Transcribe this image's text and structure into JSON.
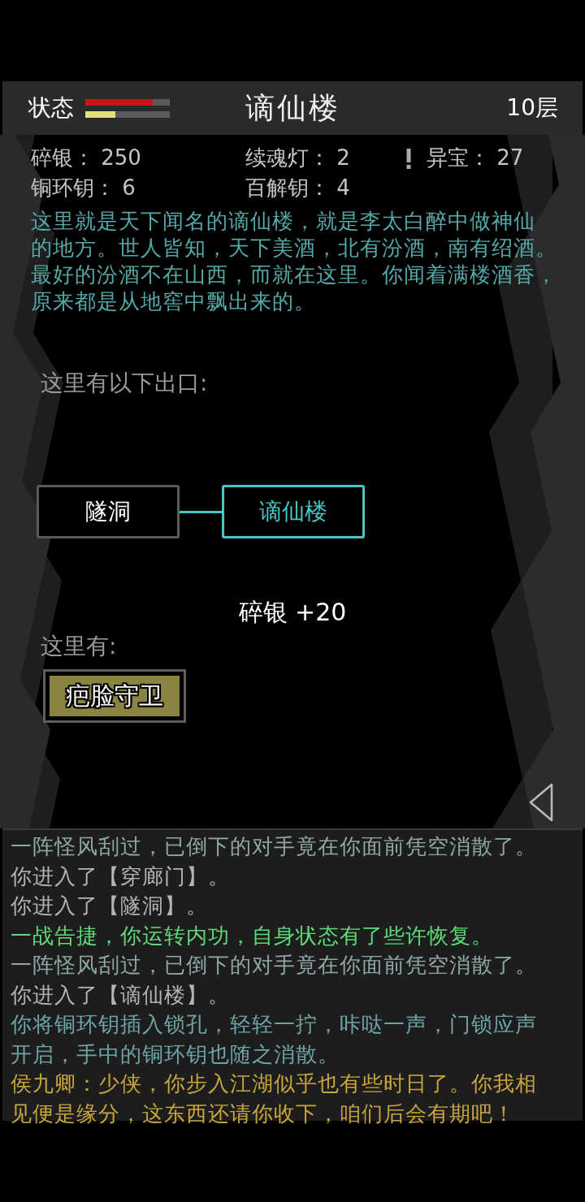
{
  "header": {
    "status_label": "状态",
    "bars": [
      {
        "kind": "health",
        "level": 0.8
      },
      {
        "kind": "energy",
        "level": 0.36
      }
    ],
    "title": "谪仙楼",
    "floor": "10层"
  },
  "stats": [
    {
      "label": "碎银：",
      "value": "250",
      "alert": false
    },
    {
      "label": "续魂灯：",
      "value": "2",
      "alert": false
    },
    {
      "label": "异宝：",
      "value": "27",
      "alert": true
    },
    {
      "label": "铜环钥：",
      "value": "6",
      "alert": false
    },
    {
      "label": "百解钥：",
      "value": "4",
      "alert": false
    }
  ],
  "description_lines": [
    "这里就是天下闻名的谪仙楼，就是李太白醉中做神仙",
    "的地方。世人皆知，天下美酒，北有汾酒，南有绍酒。",
    "最好的汾酒不在山西，而就在这里。你闻着满楼酒香，",
    "原来都是从地窖中飘出来的。"
  ],
  "exits_label": "这里有以下出口:",
  "exits": [
    {
      "name": "隧洞",
      "selected": false
    },
    {
      "name": "谪仙楼",
      "selected": true
    }
  ],
  "loot_popup": "碎银 +20",
  "here_label": "这里有:",
  "npcs": [
    {
      "name": "疤脸守卫"
    }
  ],
  "log": [
    {
      "text": "一阵怪风刮过，已倒下的对手竟在你面前凭空消散了。",
      "color": "#8fa8a6"
    },
    {
      "text": "你进入了【穿廊门】。",
      "color": "#b4b4b4"
    },
    {
      "text": "你进入了【隧洞】。",
      "color": "#b4b4b4"
    },
    {
      "text": "一战告捷，你运转内功，自身状态有了些许恢复。",
      "color": "#5edb79"
    },
    {
      "text": "一阵怪风刮过，已倒下的对手竟在你面前凭空消散了。",
      "color": "#8fa8a6"
    },
    {
      "text": "你进入了【谪仙楼】。",
      "color": "#b4b4b4"
    },
    {
      "lines": [
        "你将铜环钥插入锁孔，轻轻一拧，咔哒一声，门锁应声",
        "开启，手中的铜环钥也随之消散。"
      ],
      "color": "#6fa4a4"
    },
    {
      "lines": [
        "侯九卿：少侠，你步入江湖似乎也有些时日了。你我相",
        "见便是缘分，这东西还请你收下，咱们后会有期吧！"
      ],
      "color": "#c9a53c"
    }
  ]
}
